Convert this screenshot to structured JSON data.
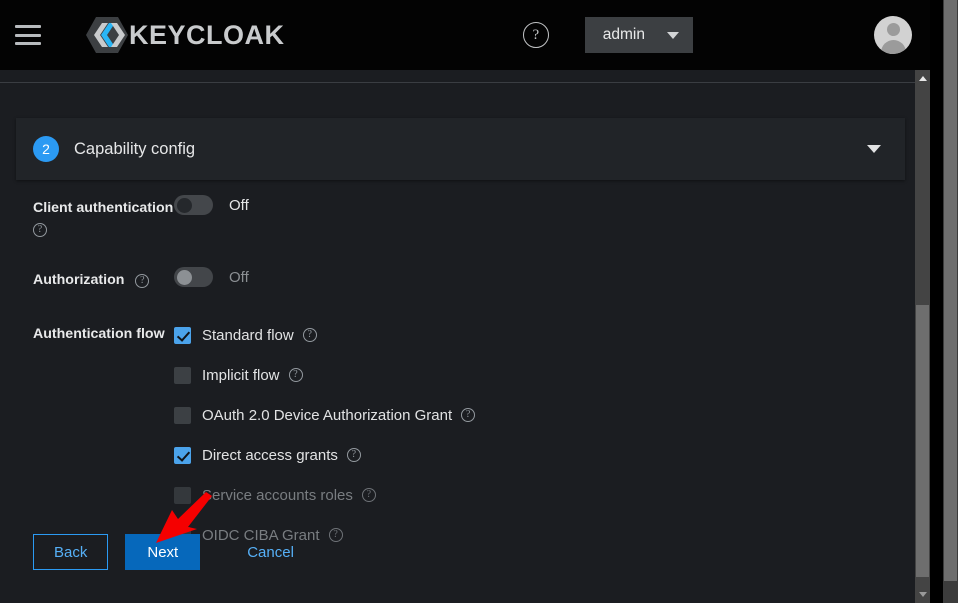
{
  "masthead": {
    "menu_icon": "hamburger-icon",
    "brand": "KEYCLOAK",
    "brand_colors": {
      "hex_accent": "#29b6f6",
      "hex_text": "#c9cbcd"
    },
    "help_icon": "question-circle-icon",
    "user_dropdown": {
      "label": "admin",
      "caret_icon": "caret-down-icon"
    },
    "avatar": "user-avatar-icon"
  },
  "content": {
    "clipped_top_text": "",
    "step": {
      "number": "2",
      "title": "Capability config",
      "collapse_icon": "caret-down-icon"
    },
    "fields": {
      "client_authentication": {
        "label": "Client authentication",
        "help_icon": "question-circle-icon",
        "state": "Off",
        "enabled": true
      },
      "authorization": {
        "label": "Authorization",
        "help_icon": "question-circle-icon",
        "state": "Off",
        "enabled": false
      },
      "authentication_flow": {
        "label": "Authentication flow",
        "left_column": [
          {
            "label": "Standard flow",
            "checked": true,
            "disabled": false,
            "help_icon": "question-circle-icon"
          },
          {
            "label": "Implicit flow",
            "checked": false,
            "disabled": false,
            "help_icon": "question-circle-icon"
          },
          {
            "label": "OAuth 2.0 Device Authorization Grant",
            "checked": false,
            "disabled": false,
            "help_icon": "question-circle-icon"
          }
        ],
        "right_column": [
          {
            "label": "Direct access grants",
            "checked": true,
            "disabled": false,
            "help_icon": "question-circle-icon"
          },
          {
            "label": "Service accounts roles",
            "checked": false,
            "disabled": true,
            "help_icon": "question-circle-icon"
          },
          {
            "label": "OIDC CIBA Grant",
            "checked": false,
            "disabled": true,
            "help_icon": "question-circle-icon"
          }
        ]
      }
    },
    "actions": {
      "back": "Back",
      "next": "Next",
      "cancel": "Cancel"
    }
  },
  "annotation": {
    "arrow_color": "#f50000",
    "points_at": "next-button"
  },
  "scrollbars": {
    "inner": {
      "up_arrow_icon": "triangle-up-icon",
      "down_arrow_icon": "triangle-down-icon"
    },
    "outer": {
      "down_arrow_icon": "triangle-down-icon"
    }
  },
  "theme": {
    "background": "#1b1d21",
    "masthead_background": "#030303",
    "accent": "#2b9af3",
    "primary_button": "#0668bb"
  }
}
